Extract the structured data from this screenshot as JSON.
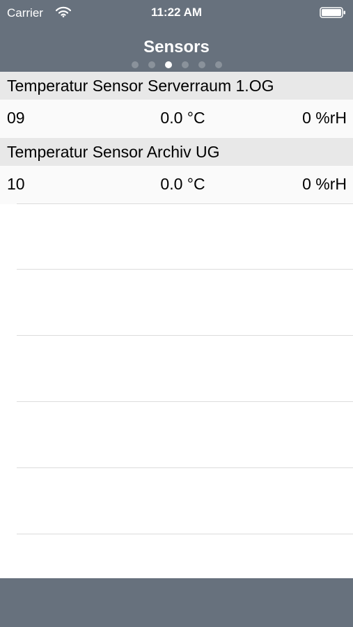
{
  "status_bar": {
    "carrier": "Carrier",
    "time": "11:22 AM",
    "icons": [
      "wifi-icon",
      "battery-icon"
    ]
  },
  "nav": {
    "title": "Sensors",
    "page_count": 6,
    "active_page": 3
  },
  "sensors": [
    {
      "name": "Temperatur Sensor Serverraum 1.OG",
      "id": "09",
      "temperature": "0.0 °C",
      "humidity": "0 %rH"
    },
    {
      "name": "Temperatur Sensor Archiv UG",
      "id": "10",
      "temperature": "0.0 °C",
      "humidity": "0 %rH"
    }
  ],
  "colors": {
    "bar_background": "#67717d",
    "section_header": "#e8e8e8",
    "row_background": "#fafafa",
    "separator": "#dcdcdc",
    "active_dot": "#ffffff",
    "inactive_dot": "#8a929b"
  }
}
